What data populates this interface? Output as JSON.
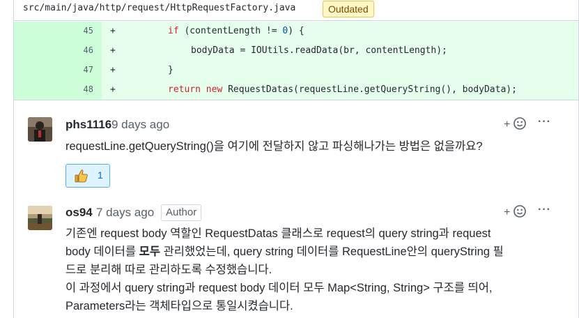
{
  "file": {
    "path": "src/main/java/http/request/HttpRequestFactory.java",
    "badge": "Outdated"
  },
  "diff": {
    "lines": [
      {
        "num": "45",
        "sign": "+"
      },
      {
        "num": "46",
        "sign": "+"
      },
      {
        "num": "47",
        "sign": "+"
      },
      {
        "num": "48",
        "sign": "+"
      }
    ],
    "code": {
      "l45_kw": "if",
      "l45_a": " (contentLength != ",
      "l45_num": "0",
      "l45_b": ") {",
      "l46": "bodyData = IOUtils.readData(br, contentLength);",
      "l47": "}",
      "l48_kw1": "return",
      "l48_kw2": "new",
      "l48_rest": " RequestDatas(requestLine.getQueryString(), bodyData);"
    }
  },
  "comments": [
    {
      "author": "phs1116",
      "time": "9 days ago",
      "body": "requestLine.getQueryString()을 여기에 전달하지 않고 파싱해나가는 방법은 없을까요?",
      "reaction": {
        "emoji": "thumbs-up",
        "count": "1"
      }
    },
    {
      "author": "os94",
      "time": "7 days ago",
      "badge": "Author",
      "body_line1": "기존엔 request body 역할인 RequestDatas 클래스로 request의 query string과 request",
      "body_line2_a": "body 데이터를 ",
      "body_line2_bold": "모두",
      "body_line2_b": " 관리했었는데, query string 데이터를 RequestLine안의 queryString 필",
      "body_line3": "드로 분리해 따로 관리하도록 수정했습니다.",
      "body_line4": "이 과정에서 query string과 request body 데이터 모두 Map<String, String> 구조를 띄어,",
      "body_line5": "Parameters라는 객체타입으로 통일시켰습니다."
    }
  ],
  "actions": {
    "add_reaction": "+",
    "more": "···"
  },
  "colors": {
    "added_bg": "#e6ffec",
    "added_num_bg": "#ccffd8",
    "keyword": "#cf222e",
    "badge_bg": "#fff8c5"
  }
}
